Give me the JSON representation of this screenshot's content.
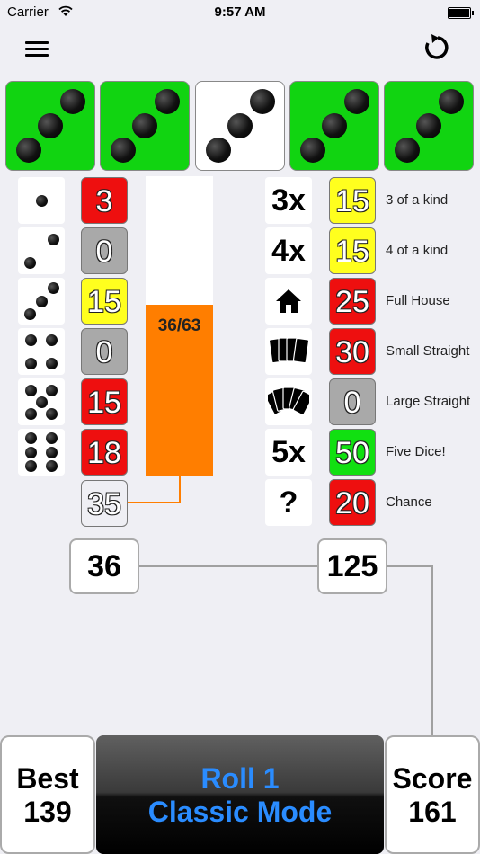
{
  "status": {
    "carrier": "Carrier",
    "time": "9:57 AM"
  },
  "nav": {
    "menu_icon": "hamburger-menu-icon",
    "undo_icon": "undo-arrow-icon"
  },
  "dice": [
    {
      "value": 3,
      "held": true
    },
    {
      "value": 3,
      "held": true
    },
    {
      "value": 3,
      "held": false
    },
    {
      "value": 3,
      "held": true
    },
    {
      "value": 3,
      "held": true
    }
  ],
  "upper": [
    {
      "face": 1,
      "score": "3",
      "color": "red"
    },
    {
      "face": 2,
      "score": "0",
      "color": "gray"
    },
    {
      "face": 3,
      "score": "15",
      "color": "yellow"
    },
    {
      "face": 4,
      "score": "0",
      "color": "gray"
    },
    {
      "face": 5,
      "score": "15",
      "color": "red"
    },
    {
      "face": 6,
      "score": "18",
      "color": "red"
    }
  ],
  "bonus": {
    "score": "35",
    "color": "gray"
  },
  "progress": {
    "text": "36/63",
    "fraction": 0.5714
  },
  "lower": [
    {
      "icon": "3x",
      "icon_name": "three-x-icon",
      "score": "15",
      "color": "yellow",
      "label": "3 of a kind"
    },
    {
      "icon": "4x",
      "icon_name": "four-x-icon",
      "score": "15",
      "color": "yellow",
      "label": "4 of a kind"
    },
    {
      "icon": "",
      "icon_name": "house-icon",
      "score": "25",
      "color": "red",
      "label": "Full House"
    },
    {
      "icon": "",
      "icon_name": "cards-four-icon",
      "score": "30",
      "color": "red",
      "label": "Small Straight"
    },
    {
      "icon": "",
      "icon_name": "cards-five-fan-icon",
      "score": "0",
      "color": "gray",
      "label": "Large Straight"
    },
    {
      "icon": "5x",
      "icon_name": "five-x-icon",
      "score": "50",
      "color": "green",
      "label": "Five Dice!"
    },
    {
      "icon": "?",
      "icon_name": "question-icon",
      "score": "20",
      "color": "red",
      "label": "Chance"
    }
  ],
  "totals": {
    "upper": "36",
    "lower": "125"
  },
  "bottom": {
    "best_label": "Best",
    "best_value": "139",
    "roll_line1": "Roll 1",
    "roll_line2": "Classic Mode",
    "score_label": "Score",
    "score_value": "161"
  },
  "colors": {
    "held": "#11d411",
    "red": "#ee0f0f",
    "gray": "#a9a9a9",
    "yellow": "#ffff1e",
    "green": "#11e011",
    "progress": "#ff7e00",
    "roll_text": "#2a8cff"
  }
}
